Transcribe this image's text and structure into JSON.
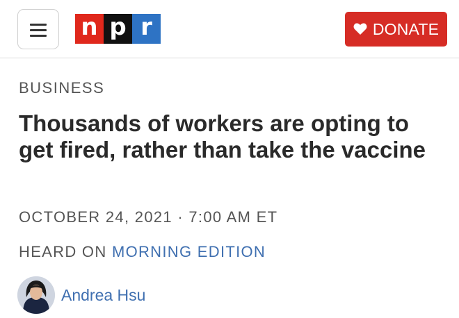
{
  "header": {
    "logo": [
      "n",
      "p",
      "r"
    ],
    "menu_icon": "hamburger-icon",
    "donate_label": "DONATE",
    "donate_icon": "heart-icon"
  },
  "article": {
    "section": "BUSINESS",
    "headline": "Thousands of workers are opting to get fired, rather than take the vaccine",
    "dateline": "OCTOBER 24, 2021 · 7:00 AM ET",
    "heard_on_prefix": "HEARD ON",
    "heard_on_show": "MORNING EDITION",
    "author": "Andrea Hsu"
  },
  "colors": {
    "accent_red": "#d62c25",
    "link_blue": "#3f6fb0",
    "logo_n": "#e0281c",
    "logo_p": "#111111",
    "logo_r": "#2e73c4"
  }
}
